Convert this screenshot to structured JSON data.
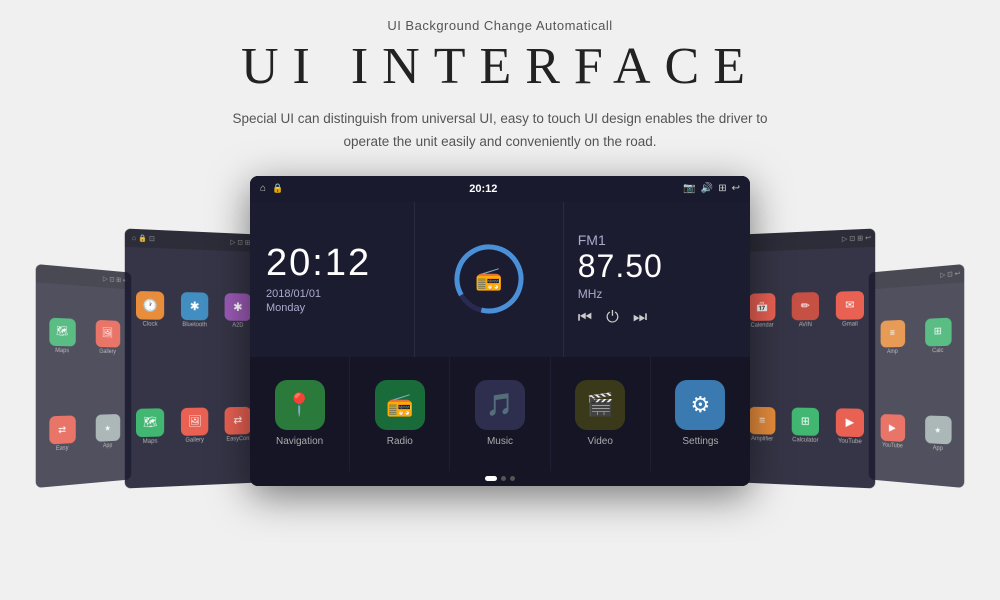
{
  "header": {
    "top_label": "UI Background Change Automaticall",
    "title": "UI INTERFACE",
    "description_line1": "Special UI can distinguish from universal UI, easy to touch UI design enables the driver to",
    "description_line2": "operate the unit easily and conveniently on the road."
  },
  "main_screen": {
    "status_bar": {
      "home_icon": "⌂",
      "lock_icon": "🔒",
      "time": "20:12",
      "camera_icon": "📷",
      "volume_icon": "🔊",
      "screen_icon": "⊞",
      "back_icon": "↩"
    },
    "clock": {
      "time": "20:12",
      "date": "2018/01/01",
      "day": "Monday"
    },
    "radio": {
      "fm_label": "FM1",
      "frequency": "87.50",
      "mhz": "MHz"
    },
    "apps": [
      {
        "label": "Navigation",
        "icon": "📍",
        "bg": "bg-nav"
      },
      {
        "label": "Radio",
        "icon": "📻",
        "bg": "bg-radio"
      },
      {
        "label": "Music",
        "icon": "🎵",
        "bg": "bg-music"
      },
      {
        "label": "Video",
        "icon": "🎬",
        "bg": "bg-video"
      },
      {
        "label": "Settings",
        "icon": "⚙",
        "bg": "bg-settings"
      }
    ]
  },
  "left_screen_near": {
    "apps": [
      {
        "icon": "🕐",
        "label": "Clock",
        "color": "#e67e22"
      },
      {
        "icon": "✱",
        "label": "Bluetooth",
        "color": "#2980b9"
      },
      {
        "icon": "✱",
        "label": "A2D",
        "color": "#8e44ad"
      },
      {
        "icon": "🗺",
        "label": "Maps",
        "color": "#27ae60"
      },
      {
        "icon": "🖼",
        "label": "Gallery",
        "color": "#e74c3c"
      },
      {
        "icon": "⇄",
        "label": "EasyCon",
        "color": "#e74c3c"
      }
    ]
  },
  "right_screen_near": {
    "apps": [
      {
        "icon": "📅",
        "label": "Calendar",
        "color": "#e74c3c"
      },
      {
        "icon": "✏",
        "label": "AVIN",
        "color": "#c0392b"
      },
      {
        "icon": "✉",
        "label": "Gmail",
        "color": "#e74c3c"
      },
      {
        "icon": "≡",
        "label": "Amplifier",
        "color": "#e67e22"
      },
      {
        "icon": "⊞",
        "label": "Calculator",
        "color": "#27ae60"
      },
      {
        "icon": "▶",
        "label": "YouTube",
        "color": "#e74c3c"
      }
    ]
  }
}
